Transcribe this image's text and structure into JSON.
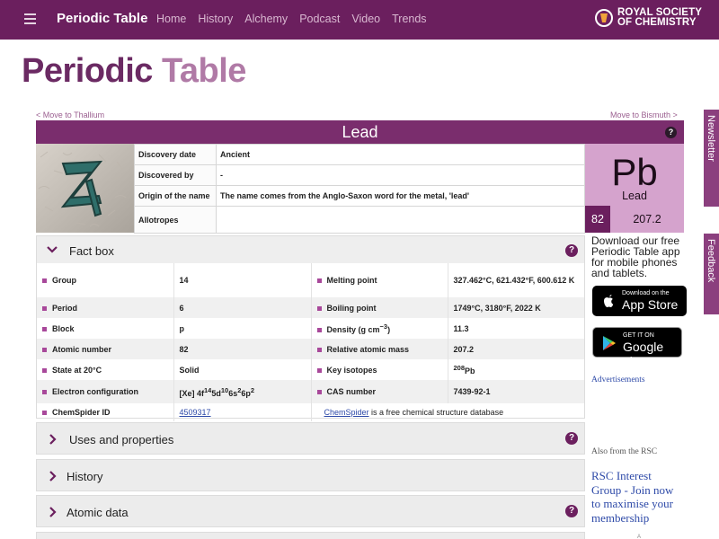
{
  "nav": {
    "brand": "Periodic Table",
    "links": [
      "Home",
      "History",
      "Alchemy",
      "Podcast",
      "Video",
      "Trends"
    ],
    "rsc_logo_line1": "ROYAL SOCIETY",
    "rsc_logo_line2": "OF CHEMISTRY"
  },
  "page": {
    "title_part1": "Periodic",
    "title_part2": "Table",
    "prev_link": "< Move to Thallium",
    "next_link": "Move to Bismuth >"
  },
  "element": {
    "name": "Lead",
    "symbol": "Pb",
    "atomic_number": "82",
    "atomic_mass": "207.2",
    "help": "?",
    "info": [
      {
        "label": "Discovery date",
        "value": "Ancient"
      },
      {
        "label": "Discovered by",
        "value": "-"
      },
      {
        "label": "Origin of the name",
        "value": "The name comes from the Anglo-Saxon word for the metal, 'lead'"
      },
      {
        "label": "Allotropes",
        "value": ""
      }
    ]
  },
  "factbox": {
    "title": "Fact box",
    "rows": [
      {
        "k1": "Group",
        "v1": "14",
        "k2": "Melting point",
        "v2": "327.462°C, 621.432°F, 600.612 K"
      },
      {
        "k1": "Period",
        "v1": "6",
        "k2": "Boiling point",
        "v2": "1749°C, 3180°F, 2022 K"
      },
      {
        "k1": "Block",
        "v1": "p",
        "k2": "Density (g cm−3)",
        "v2": "11.3"
      },
      {
        "k1": "Atomic number",
        "v1": "82",
        "k2": "Relative atomic mass",
        "v2": "207.2"
      },
      {
        "k1": "State at 20°C",
        "v1": "Solid",
        "k2": "Key isotopes",
        "v2": "208Pb"
      },
      {
        "k1": "Electron configuration",
        "v1": "[Xe] 4f145d106s26p2",
        "k2": "CAS number",
        "v2": "7439-92-1"
      }
    ],
    "chemspider_label": "ChemSpider ID",
    "chemspider_id": "4509317",
    "chemspider_link": "ChemSpider",
    "chemspider_text": " is a free chemical structure database"
  },
  "sections": {
    "uses": "Uses and properties",
    "history": "History",
    "atomic": "Atomic data"
  },
  "sidebar": {
    "app_promo": "Download our free Periodic Table app for mobile phones and tablets.",
    "appstore_small": "Download on the",
    "appstore_big": "App Store",
    "gplay_small": "GET IT ON",
    "gplay_big": "Google play",
    "advertisements": "Advertisements",
    "also_from": "Also from the RSC",
    "rsc_interest": "RSC Interest Group - Join now to maximise your membership",
    "tiny": "A"
  },
  "tabs": {
    "newsletter": "Newsletter",
    "feedback": "Feedback"
  },
  "colors": {
    "nav_bg": "#6b1f5e",
    "accent": "#7a2d6d",
    "tile_bg": "#d5a3cd"
  }
}
